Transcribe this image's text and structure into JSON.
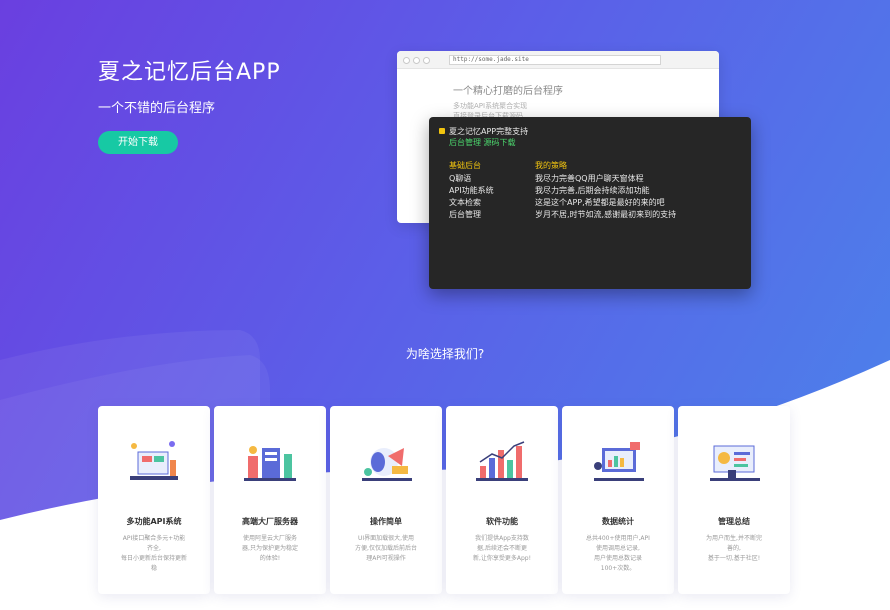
{
  "hero": {
    "title": "夏之记忆后台APP",
    "subtitle": "一个不错的后台程序",
    "download_label": "开始下载"
  },
  "browser": {
    "url": "http://some.jade.site",
    "heading": "一个精心打磨的后台程序",
    "lines": [
      "多功能API系统聚合实现",
      "直接登录后台下载源码"
    ]
  },
  "terminal": {
    "line1": "夏之记忆APP完整支持",
    "line2": "后台管理  源码下载",
    "col_left_head": "基础后台",
    "col_right_head": "我的策略",
    "rows": [
      {
        "left": "Q聊语",
        "right": "我尽力完善QQ用户聊天窗体程"
      },
      {
        "left": "API功能系统",
        "right": "我尽力完善,后期会持续添加功能"
      },
      {
        "left": "文本检索",
        "right": "这是这个APP,希望都是最好的来的吧"
      },
      {
        "left": "后台管理",
        "right": "岁月不居,时节如流,感谢最初来到的支持"
      }
    ],
    "colors": {
      "yellow": "#f1c40f",
      "green": "#4cd66d",
      "white": "#e8e8e8"
    }
  },
  "section": {
    "title": "为啥选择我们?"
  },
  "cards": [
    {
      "title": "多功能API系统",
      "desc": "API接口聚合多元+功能\n齐全,\n每日小更新后台保持更新\n稳",
      "icon": "workspace-illustration-icon"
    },
    {
      "title": "高端大厂服务器",
      "desc": "使用阿里云大厂服务\n器,只为保护更为稳定\n的体验!",
      "icon": "server-illustration-icon"
    },
    {
      "title": "操作简单",
      "desc": "UI界面加载很大,使用\n方便,仅仅加载后前后台\n理API可视操作",
      "icon": "mouse-illustration-icon"
    },
    {
      "title": "软件功能",
      "desc": "我们提供App支持数\n据,后续还会不断更\n新,让你享受更多App!",
      "icon": "chart-illustration-icon"
    },
    {
      "title": "数据统计",
      "desc": "总共400+使用用户,API\n使用调用总记录,\n用户使用总数记录\n100+次数。",
      "icon": "monitor-illustration-icon"
    },
    {
      "title": "管理总结",
      "desc": "为用户而生,并不断完\n善的,\n基于一切,基于社区!",
      "icon": "dashboard-illustration-icon"
    }
  ]
}
